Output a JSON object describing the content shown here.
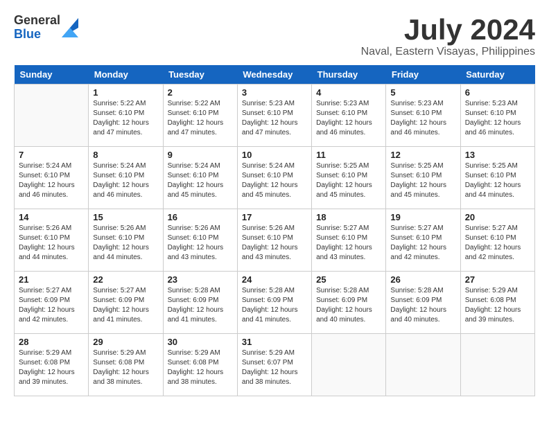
{
  "logo": {
    "general": "General",
    "blue": "Blue"
  },
  "title": "July 2024",
  "subtitle": "Naval, Eastern Visayas, Philippines",
  "days_of_week": [
    "Sunday",
    "Monday",
    "Tuesday",
    "Wednesday",
    "Thursday",
    "Friday",
    "Saturday"
  ],
  "weeks": [
    [
      {
        "day": "",
        "info": ""
      },
      {
        "day": "1",
        "info": "Sunrise: 5:22 AM\nSunset: 6:10 PM\nDaylight: 12 hours\nand 47 minutes."
      },
      {
        "day": "2",
        "info": "Sunrise: 5:22 AM\nSunset: 6:10 PM\nDaylight: 12 hours\nand 47 minutes."
      },
      {
        "day": "3",
        "info": "Sunrise: 5:23 AM\nSunset: 6:10 PM\nDaylight: 12 hours\nand 47 minutes."
      },
      {
        "day": "4",
        "info": "Sunrise: 5:23 AM\nSunset: 6:10 PM\nDaylight: 12 hours\nand 46 minutes."
      },
      {
        "day": "5",
        "info": "Sunrise: 5:23 AM\nSunset: 6:10 PM\nDaylight: 12 hours\nand 46 minutes."
      },
      {
        "day": "6",
        "info": "Sunrise: 5:23 AM\nSunset: 6:10 PM\nDaylight: 12 hours\nand 46 minutes."
      }
    ],
    [
      {
        "day": "7",
        "info": "Sunrise: 5:24 AM\nSunset: 6:10 PM\nDaylight: 12 hours\nand 46 minutes."
      },
      {
        "day": "8",
        "info": "Sunrise: 5:24 AM\nSunset: 6:10 PM\nDaylight: 12 hours\nand 46 minutes."
      },
      {
        "day": "9",
        "info": "Sunrise: 5:24 AM\nSunset: 6:10 PM\nDaylight: 12 hours\nand 45 minutes."
      },
      {
        "day": "10",
        "info": "Sunrise: 5:24 AM\nSunset: 6:10 PM\nDaylight: 12 hours\nand 45 minutes."
      },
      {
        "day": "11",
        "info": "Sunrise: 5:25 AM\nSunset: 6:10 PM\nDaylight: 12 hours\nand 45 minutes."
      },
      {
        "day": "12",
        "info": "Sunrise: 5:25 AM\nSunset: 6:10 PM\nDaylight: 12 hours\nand 45 minutes."
      },
      {
        "day": "13",
        "info": "Sunrise: 5:25 AM\nSunset: 6:10 PM\nDaylight: 12 hours\nand 44 minutes."
      }
    ],
    [
      {
        "day": "14",
        "info": "Sunrise: 5:26 AM\nSunset: 6:10 PM\nDaylight: 12 hours\nand 44 minutes."
      },
      {
        "day": "15",
        "info": "Sunrise: 5:26 AM\nSunset: 6:10 PM\nDaylight: 12 hours\nand 44 minutes."
      },
      {
        "day": "16",
        "info": "Sunrise: 5:26 AM\nSunset: 6:10 PM\nDaylight: 12 hours\nand 43 minutes."
      },
      {
        "day": "17",
        "info": "Sunrise: 5:26 AM\nSunset: 6:10 PM\nDaylight: 12 hours\nand 43 minutes."
      },
      {
        "day": "18",
        "info": "Sunrise: 5:27 AM\nSunset: 6:10 PM\nDaylight: 12 hours\nand 43 minutes."
      },
      {
        "day": "19",
        "info": "Sunrise: 5:27 AM\nSunset: 6:10 PM\nDaylight: 12 hours\nand 42 minutes."
      },
      {
        "day": "20",
        "info": "Sunrise: 5:27 AM\nSunset: 6:10 PM\nDaylight: 12 hours\nand 42 minutes."
      }
    ],
    [
      {
        "day": "21",
        "info": "Sunrise: 5:27 AM\nSunset: 6:09 PM\nDaylight: 12 hours\nand 42 minutes."
      },
      {
        "day": "22",
        "info": "Sunrise: 5:27 AM\nSunset: 6:09 PM\nDaylight: 12 hours\nand 41 minutes."
      },
      {
        "day": "23",
        "info": "Sunrise: 5:28 AM\nSunset: 6:09 PM\nDaylight: 12 hours\nand 41 minutes."
      },
      {
        "day": "24",
        "info": "Sunrise: 5:28 AM\nSunset: 6:09 PM\nDaylight: 12 hours\nand 41 minutes."
      },
      {
        "day": "25",
        "info": "Sunrise: 5:28 AM\nSunset: 6:09 PM\nDaylight: 12 hours\nand 40 minutes."
      },
      {
        "day": "26",
        "info": "Sunrise: 5:28 AM\nSunset: 6:09 PM\nDaylight: 12 hours\nand 40 minutes."
      },
      {
        "day": "27",
        "info": "Sunrise: 5:29 AM\nSunset: 6:08 PM\nDaylight: 12 hours\nand 39 minutes."
      }
    ],
    [
      {
        "day": "28",
        "info": "Sunrise: 5:29 AM\nSunset: 6:08 PM\nDaylight: 12 hours\nand 39 minutes."
      },
      {
        "day": "29",
        "info": "Sunrise: 5:29 AM\nSunset: 6:08 PM\nDaylight: 12 hours\nand 38 minutes."
      },
      {
        "day": "30",
        "info": "Sunrise: 5:29 AM\nSunset: 6:08 PM\nDaylight: 12 hours\nand 38 minutes."
      },
      {
        "day": "31",
        "info": "Sunrise: 5:29 AM\nSunset: 6:07 PM\nDaylight: 12 hours\nand 38 minutes."
      },
      {
        "day": "",
        "info": ""
      },
      {
        "day": "",
        "info": ""
      },
      {
        "day": "",
        "info": ""
      }
    ]
  ]
}
